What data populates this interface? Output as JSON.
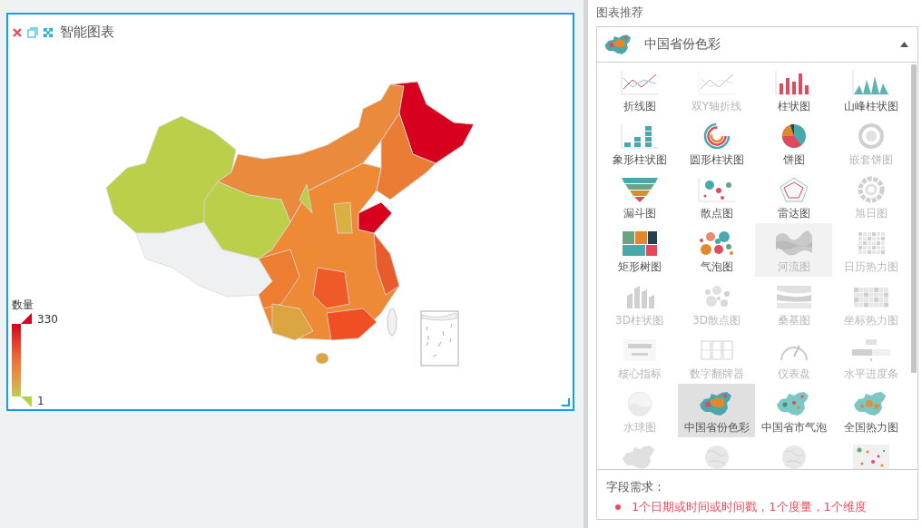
{
  "card": {
    "title": "智能图表"
  },
  "legend": {
    "title": "数量",
    "max": "330",
    "min": "1"
  },
  "panel": {
    "label": "图表推荐"
  },
  "dropdown": {
    "value": "中国省份色彩",
    "expanded": true
  },
  "chart_types": [
    {
      "label": "折线图",
      "disabled": false,
      "selected": false,
      "hovered": false
    },
    {
      "label": "双Y轴折线",
      "disabled": true,
      "selected": false,
      "hovered": false
    },
    {
      "label": "柱状图",
      "disabled": false,
      "selected": false,
      "hovered": false
    },
    {
      "label": "山峰柱状图",
      "disabled": false,
      "selected": false,
      "hovered": false
    },
    {
      "label": "象形柱状图",
      "disabled": false,
      "selected": false,
      "hovered": false
    },
    {
      "label": "圆形柱状图",
      "disabled": false,
      "selected": false,
      "hovered": false
    },
    {
      "label": "饼图",
      "disabled": false,
      "selected": false,
      "hovered": false
    },
    {
      "label": "嵌套饼图",
      "disabled": true,
      "selected": false,
      "hovered": false
    },
    {
      "label": "漏斗图",
      "disabled": false,
      "selected": false,
      "hovered": false
    },
    {
      "label": "散点图",
      "disabled": false,
      "selected": false,
      "hovered": false
    },
    {
      "label": "雷达图",
      "disabled": false,
      "selected": false,
      "hovered": false
    },
    {
      "label": "旭日图",
      "disabled": true,
      "selected": false,
      "hovered": false
    },
    {
      "label": "矩形树图",
      "disabled": false,
      "selected": false,
      "hovered": false
    },
    {
      "label": "气泡图",
      "disabled": false,
      "selected": false,
      "hovered": false
    },
    {
      "label": "河流图",
      "disabled": true,
      "selected": false,
      "hovered": true
    },
    {
      "label": "日历热力图",
      "disabled": true,
      "selected": false,
      "hovered": false
    },
    {
      "label": "3D柱状图",
      "disabled": true,
      "selected": false,
      "hovered": false
    },
    {
      "label": "3D散点图",
      "disabled": true,
      "selected": false,
      "hovered": false
    },
    {
      "label": "桑基图",
      "disabled": true,
      "selected": false,
      "hovered": false
    },
    {
      "label": "坐标热力图",
      "disabled": true,
      "selected": false,
      "hovered": false
    },
    {
      "label": "核心指标",
      "disabled": true,
      "selected": false,
      "hovered": false
    },
    {
      "label": "数字翻牌器",
      "disabled": true,
      "selected": false,
      "hovered": false
    },
    {
      "label": "仪表盘",
      "disabled": true,
      "selected": false,
      "hovered": false
    },
    {
      "label": "水平进度条",
      "disabled": true,
      "selected": false,
      "hovered": false
    },
    {
      "label": "水球图",
      "disabled": true,
      "selected": false,
      "hovered": false
    },
    {
      "label": "中国省份色彩",
      "disabled": false,
      "selected": true,
      "hovered": false
    },
    {
      "label": "中国省市气泡",
      "disabled": false,
      "selected": false,
      "hovered": false
    },
    {
      "label": "全国热力图",
      "disabled": false,
      "selected": false,
      "hovered": false
    },
    {
      "disabled": true,
      "selected": false,
      "hovered": false
    },
    {
      "disabled": true,
      "selected": false,
      "hovered": false
    },
    {
      "disabled": true,
      "selected": false,
      "hovered": false
    },
    {
      "disabled": false,
      "selected": false,
      "hovered": false
    }
  ],
  "requirements": {
    "title": "字段需求：",
    "items": [
      "1个日期或时间或时间戳，1个度量，1个维度"
    ]
  }
}
